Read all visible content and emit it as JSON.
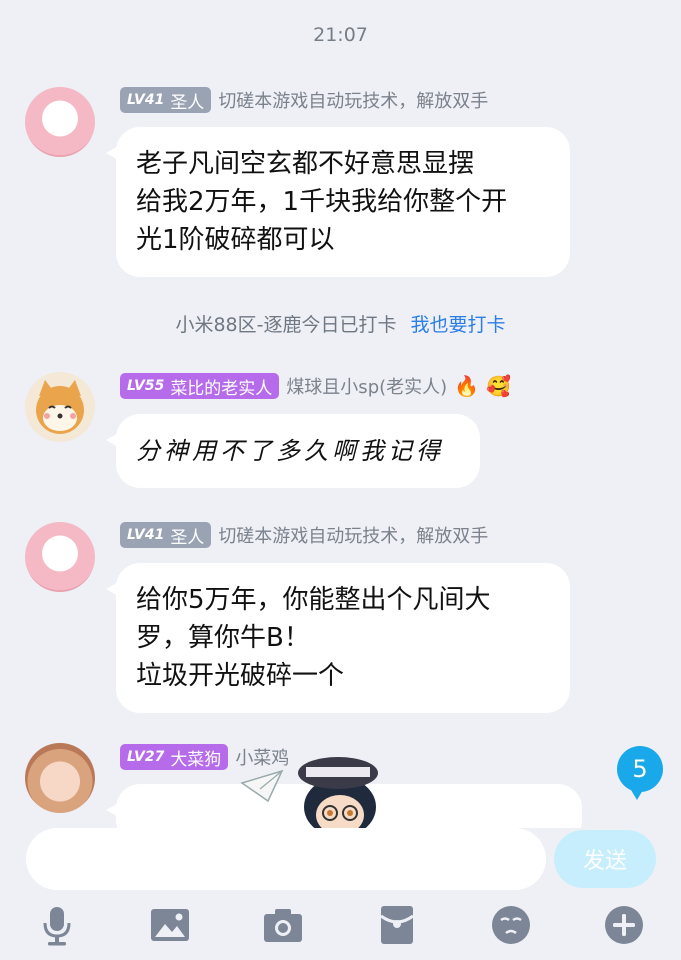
{
  "status": {
    "time": "21:07"
  },
  "messages": [
    {
      "level": "LV41",
      "title": "圣人",
      "subtitle": "切磋本游戏自动玩技术，解放双手",
      "lines": [
        "老子凡间空玄都不好意思显摆",
        "给我2万年，1千块我给你整个开",
        "光1阶破碎都可以"
      ]
    },
    {
      "level": "LV55",
      "title": "菜比的老实人",
      "subtitle": "煤球且小sp(老实人)",
      "lines": [
        "分神用不了多久啊我记得"
      ]
    },
    {
      "level": "LV41",
      "title": "圣人",
      "subtitle": "切磋本游戏自动玩技术，解放双手",
      "lines": [
        "给你5万年，你能整出个凡间大",
        "罗，算你牛B！",
        "垃圾开光破碎一个"
      ]
    },
    {
      "level": "LV27",
      "title": "大菜狗",
      "subtitle": "小菜鸡"
    }
  ],
  "checkin": {
    "text": "小米88区-逐鹿今日已打卡",
    "link": "我也要打卡"
  },
  "unread_count": "5",
  "composer": {
    "send_label": "发送",
    "placeholder": ""
  },
  "toolbar_icons": [
    "microphone-icon",
    "image-icon",
    "camera-icon",
    "red-packet-icon",
    "emoji-icon",
    "plus-icon"
  ],
  "colors": {
    "link": "#2b7ee6",
    "badge_gray": "#9aa3b4",
    "badge_purple": "#b66bea",
    "unread": "#19a8ea",
    "send_disabled": "#c7eefc"
  }
}
